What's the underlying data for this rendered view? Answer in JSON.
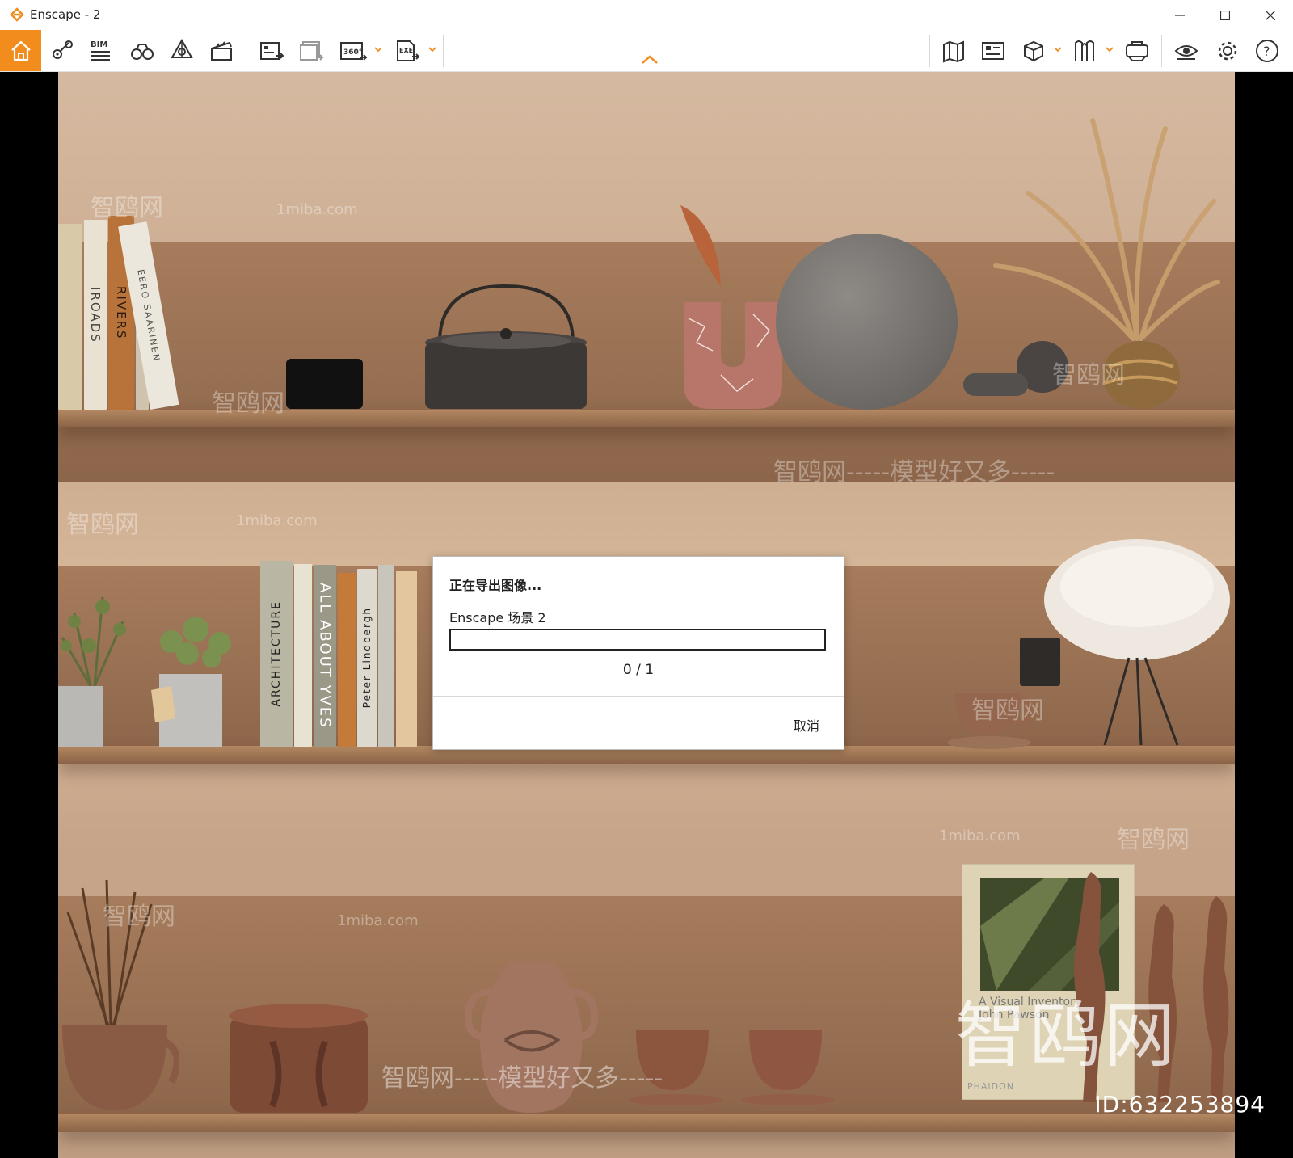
{
  "window": {
    "title": "Enscape - 2",
    "accent": "#f28c1d"
  },
  "toolbar": {
    "left_tools": [
      "home-icon",
      "pin-views-icon",
      "bim-icon",
      "binoculars-icon",
      "asset-library-icon",
      "video-editor-icon",
      "render-image-icon",
      "batch-render-icon",
      "panorama-360-icon",
      "export-exe-icon"
    ],
    "right_tools": [
      "map-icon",
      "screenshot-list-icon",
      "cube-view-icon",
      "bookmark-icon",
      "vr-headset-icon",
      "visual-settings-icon",
      "gear-icon",
      "help-icon"
    ],
    "bim_label": "BIM",
    "pano_label": "360°",
    "exe_label": "EXE"
  },
  "scene": {
    "books_top": [
      "IROADS",
      "RIVERS",
      "EERO SAARINEN"
    ],
    "books_mid": [
      "ARCHITECTURE",
      "ALL ABOUT YVES",
      "Peter Lindbergh"
    ],
    "book_cover_title": "A Visual Inventory",
    "book_cover_author": "John Pawson",
    "book_publisher": "PHAIDON",
    "watermark_main": "智鸥网-----模型好又多-----",
    "watermark_small": "智鸥网",
    "watermark_site": "1miba.com",
    "big_watermark": "智鸥网",
    "id_text": "ID:632253894"
  },
  "dialog": {
    "title": "正在导出图像...",
    "scene_name": "Enscape 场景 2",
    "progress_fraction": 0,
    "count": "0 / 1",
    "cancel_label": "取消"
  }
}
